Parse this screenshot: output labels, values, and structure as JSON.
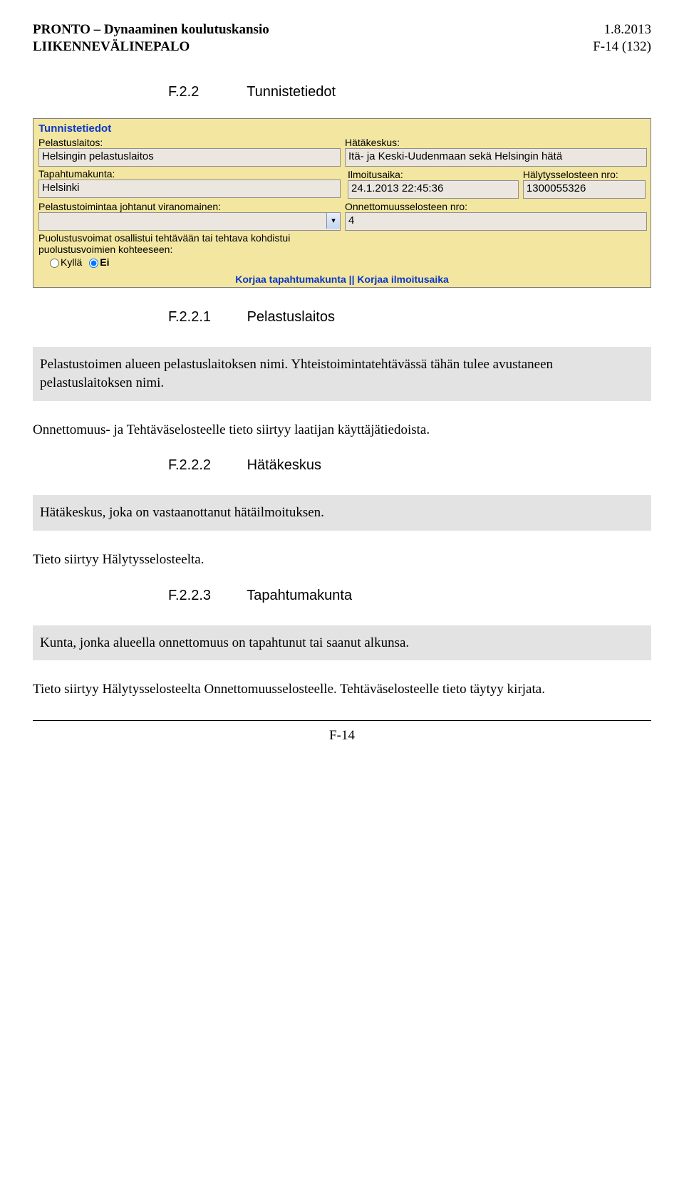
{
  "header": {
    "title1": "PRONTO – Dynaaminen koulutuskansio",
    "title2": "LIIKENNEVÄLINEPALO",
    "date": "1.8.2013",
    "pagecode": "F-14 (132)"
  },
  "section": {
    "f22_num": "F.2.2",
    "f22_title": "Tunnistetiedot",
    "f221_num": "F.2.2.1",
    "f221_title": "Pelastuslaitos",
    "f222_num": "F.2.2.2",
    "f222_title": "Hätäkeskus",
    "f223_num": "F.2.2.3",
    "f223_title": "Tapahtumakunta"
  },
  "form": {
    "panel_title": "Tunnistetiedot",
    "labels": {
      "pelastuslaitos": "Pelastuslaitos:",
      "hatakeskus": "Hätäkeskus:",
      "tapahtumakunta": "Tapahtumakunta:",
      "ilmoitusaika": "Ilmoitusaika:",
      "halytysselosteen": "Hälytysselosteen nro:",
      "viranomainen": "Pelastustoimintaa johtanut viranomainen:",
      "onnettomuus_nro": "Onnettomuusselosteen nro:",
      "puolustus1": "Puolustusvoimat osallistui tehtävään tai tehtava kohdistui",
      "puolustus2": "puolustusvoimien kohteeseen:",
      "kylla": "Kyllä",
      "ei": "Ei"
    },
    "values": {
      "pelastuslaitos": "Helsingin pelastuslaitos",
      "hatakeskus": "Itä- ja Keski-Uudenmaan sekä Helsingin hätä",
      "tapahtumakunta": "Helsinki",
      "ilmoitusaika": "24.1.2013 22:45:36",
      "halytysselosteen": "1300055326",
      "viranomainen": "",
      "onnettomuus_nro": "4"
    },
    "linkbar": "Korjaa tapahtumakunta || Korjaa ilmoitusaika"
  },
  "blocks": {
    "b1": "Pelastustoimen alueen pelastuslaitoksen nimi. Yhteistoimintatehtävässä tähän tulee avustaneen pelastuslaitoksen nimi.",
    "p1": "Onnettomuus- ja Tehtäväselosteelle tieto siirtyy laatijan käyttäjätiedoista.",
    "b2": "Hätäkeskus, joka on vastaanottanut hätäilmoituksen.",
    "p2": "Tieto siirtyy Hälytysselosteelta.",
    "b3": "Kunta, jonka alueella onnettomuus on tapahtunut tai saanut alkunsa.",
    "p3": "Tieto siirtyy Hälytysselosteelta Onnettomuusselosteelle. Tehtäväselosteelle tieto täytyy kirjata."
  },
  "footer": {
    "page": "F-14"
  }
}
